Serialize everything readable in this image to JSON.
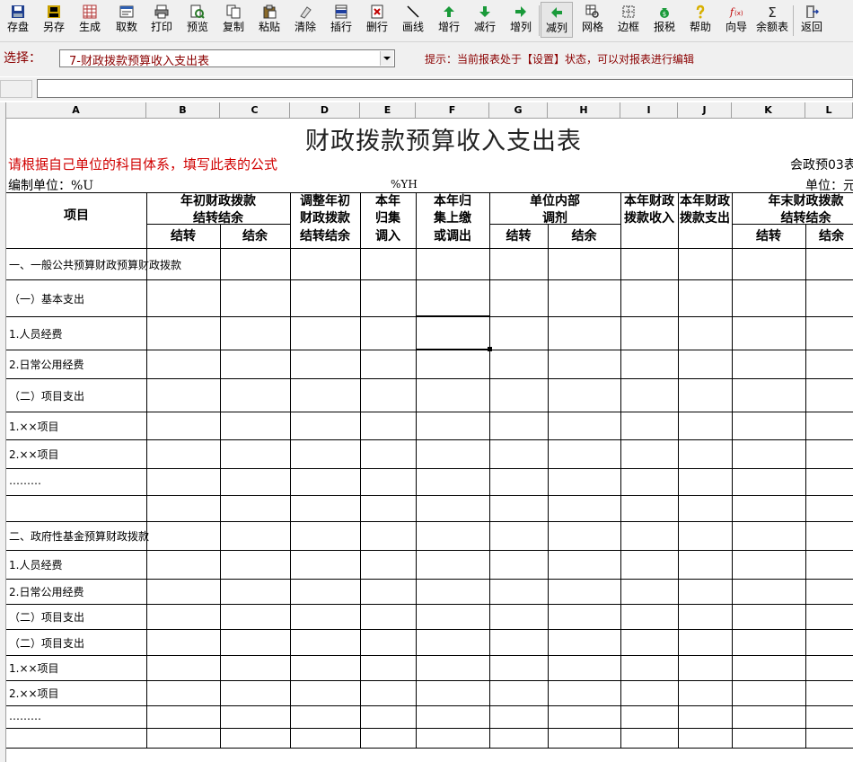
{
  "toolbar": {
    "buttons": [
      {
        "id": "save",
        "label": "存盘",
        "icon": "floppy-icon"
      },
      {
        "id": "saveas",
        "label": "另存",
        "icon": "save-as-icon"
      },
      {
        "id": "generate",
        "label": "生成",
        "icon": "grid-generate-icon"
      },
      {
        "id": "fetch",
        "label": "取数",
        "icon": "fetch-data-icon"
      },
      {
        "id": "print",
        "label": "打印",
        "icon": "printer-icon"
      },
      {
        "id": "preview",
        "label": "预览",
        "icon": "preview-icon"
      },
      {
        "id": "copy",
        "label": "复制",
        "icon": "copy-icon"
      },
      {
        "id": "paste",
        "label": "粘贴",
        "icon": "paste-icon"
      },
      {
        "id": "clear",
        "label": "清除",
        "icon": "eraser-icon"
      },
      {
        "id": "insert-row",
        "label": "插行",
        "icon": "insert-row-icon"
      },
      {
        "id": "delete-row",
        "label": "删行",
        "icon": "delete-row-icon"
      },
      {
        "id": "draw-line",
        "label": "画线",
        "icon": "diagonal-line-icon"
      },
      {
        "id": "add-row",
        "label": "增行",
        "icon": "add-row-icon"
      },
      {
        "id": "reduce-row",
        "label": "减行",
        "icon": "reduce-row-icon"
      },
      {
        "id": "add-col",
        "label": "增列",
        "icon": "add-column-icon"
      },
      {
        "id": "reduce-col",
        "label": "减列",
        "icon": "reduce-column-icon"
      },
      {
        "id": "grid",
        "label": "网格",
        "icon": "grid-magnifier-icon"
      },
      {
        "id": "border",
        "label": "边框",
        "icon": "border-icon"
      },
      {
        "id": "tax",
        "label": "报税",
        "icon": "money-bag-icon"
      },
      {
        "id": "help",
        "label": "帮助",
        "icon": "help-icon"
      },
      {
        "id": "wizard",
        "label": "向导",
        "icon": "function-icon"
      },
      {
        "id": "balance",
        "label": "余额表",
        "icon": "sigma-icon"
      },
      {
        "id": "back",
        "label": "返回",
        "icon": "exit-door-icon"
      }
    ]
  },
  "selector": {
    "label": "选择：",
    "selected": "7-财政拨款预算收入支出表",
    "hint": "提示：当前报表处于【设置】状态，可以对报表进行编辑"
  },
  "columns": [
    "A",
    "B",
    "C",
    "D",
    "E",
    "F",
    "G",
    "H",
    "I",
    "J",
    "K",
    "L"
  ],
  "sheet": {
    "title": "财政拨款预算收入支出表",
    "formula_note": "请根据自己单位的科目体系，填写此表的公式",
    "form_code": "会政预03表",
    "unit_label": "编制单位：%U",
    "yh_label": "%YH",
    "money_unit": "单位：元",
    "headers": {
      "item": "项目",
      "begin_balance": "年初财政拨款\n结转结余",
      "adjust_begin": "调整年初\n财政拨款",
      "adjust_sub": "结转结余",
      "current_collect": "本年\n归集",
      "current_collect_sub": "调入",
      "current_return": "本年归\n集上缴",
      "current_return_sub": "或调出",
      "internal_adjust": "单位内部\n调剂",
      "income": "本年财政\n拨款收入",
      "expense": "本年财政\n拨款支出",
      "end_balance": "年末财政拨款\n结转结余",
      "carry": "结转",
      "surplus": "结余"
    },
    "rows": [
      "一、一般公共预算财政预算财政拨款",
      "（一）基本支出",
      "1.人员经费",
      "2.日常公用经费",
      "（二）项目支出",
      "1.××项目",
      "2.××项目",
      "………",
      "",
      "二、政府性基金预算财政拨款",
      "1.人员经费",
      "2.日常公用经费",
      "（二）项目支出",
      "（二）项目支出",
      "1.××项目",
      "2.××项目",
      "………",
      ""
    ]
  }
}
